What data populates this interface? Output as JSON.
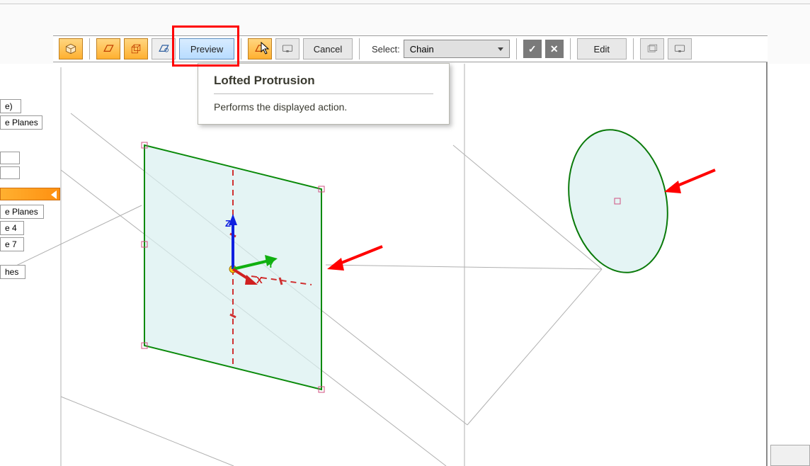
{
  "toolbar": {
    "preview_label": "Preview",
    "cancel_label": "Cancel",
    "select_label": "Select:",
    "select_value": "Chain",
    "edit_label": "Edit"
  },
  "tooltip": {
    "title": "Lofted Protrusion",
    "body": "Performs the displayed action."
  },
  "left_panel": {
    "item_e": "e)",
    "item_planes": "e Planes",
    "item_eplanes2": "e Planes",
    "item_e4": "e 4",
    "item_e7": "e 7",
    "item_hes": "hes"
  },
  "axes": {
    "x": "X",
    "y": "Y",
    "z": "Z"
  }
}
